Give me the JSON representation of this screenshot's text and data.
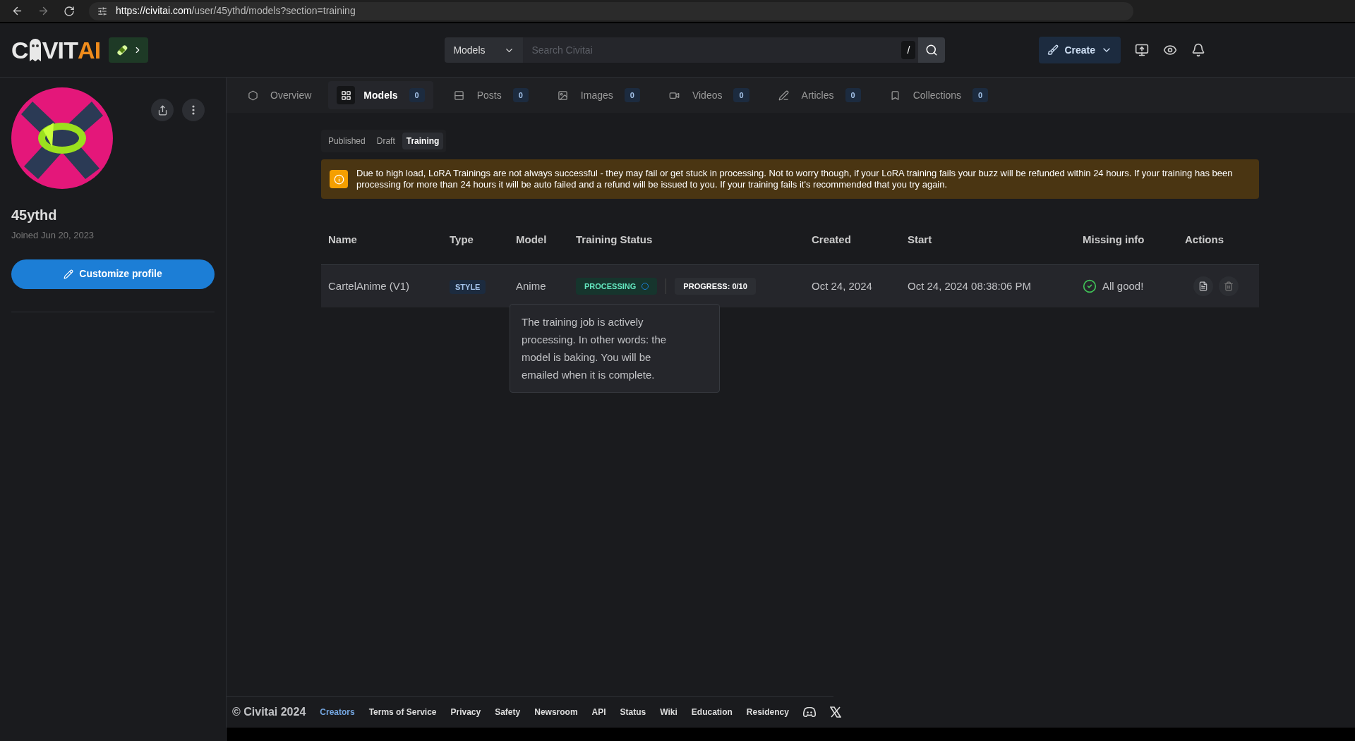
{
  "browser": {
    "url_host": "https://civitai.com",
    "url_path": "/user/45ythd/models?section=training"
  },
  "header": {
    "logo": {
      "prefix": "C",
      "middle": "VIT",
      "accent": "AI"
    },
    "search_scope": "Models",
    "search_placeholder": "Search Civitai",
    "shortcut": "/",
    "create_label": "Create"
  },
  "profile": {
    "username": "45ythd",
    "joined": "Joined Jun 20, 2023",
    "customize_label": "Customize profile"
  },
  "tabs": [
    {
      "kind": "overview",
      "label": "Overview",
      "selected": false
    },
    {
      "kind": "models",
      "label": "Models",
      "count": "0",
      "selected": true
    },
    {
      "kind": "posts",
      "label": "Posts",
      "count": "0",
      "selected": false
    },
    {
      "kind": "images",
      "label": "Images",
      "count": "0",
      "selected": false
    },
    {
      "kind": "videos",
      "label": "Videos",
      "count": "0",
      "selected": false
    },
    {
      "kind": "articles",
      "label": "Articles",
      "count": "0",
      "selected": false
    },
    {
      "kind": "collections",
      "label": "Collections",
      "count": "0",
      "selected": false
    }
  ],
  "sections": [
    {
      "label": "Published",
      "selected": false
    },
    {
      "label": "Draft",
      "selected": false
    },
    {
      "label": "Training",
      "selected": true
    }
  ],
  "alert": "Due to high load, LoRA Trainings are not always successful - they may fail or get stuck in processing. Not to worry though, if your LoRA training fails your buzz will be refunded within 24 hours. If your training has been processing for more than 24 hours it will be auto failed and a refund will be issued to you. If your training fails it's recommended that you try again.",
  "table": {
    "columns": [
      "Name",
      "Type",
      "Model",
      "Training Status",
      "Created",
      "Start",
      "Missing info",
      "Actions"
    ],
    "rows": [
      {
        "name": "CartelAnime (V1)",
        "type": "STYLE",
        "model": "Anime",
        "status": "PROCESSING",
        "progress": "PROGRESS: 0/10",
        "created": "Oct 24, 2024",
        "start": "Oct 24, 2024 08:38:06 PM",
        "missing_info": "All good!"
      }
    ]
  },
  "tooltip": "The training job is actively processing. In other words: the model is baking. You will be emailed when it is complete.",
  "footer": {
    "copyright": "© Civitai 2024",
    "links": [
      {
        "label": "Creators",
        "highlighted": true
      },
      {
        "label": "Terms of Service",
        "highlighted": false
      },
      {
        "label": "Privacy",
        "highlighted": false
      },
      {
        "label": "Safety",
        "highlighted": false
      },
      {
        "label": "Newsroom",
        "highlighted": false
      },
      {
        "label": "API",
        "highlighted": false
      },
      {
        "label": "Status",
        "highlighted": false
      },
      {
        "label": "Wiki",
        "highlighted": false
      },
      {
        "label": "Education",
        "highlighted": false
      },
      {
        "label": "Residency",
        "highlighted": false
      }
    ]
  }
}
